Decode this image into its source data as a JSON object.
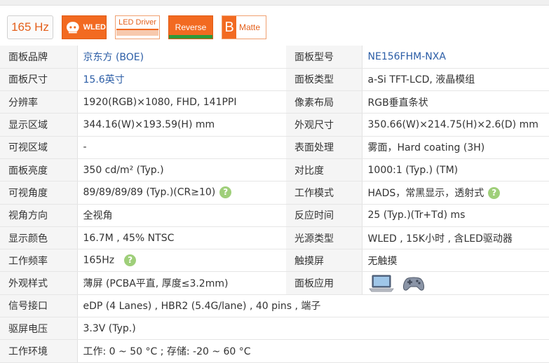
{
  "badges": {
    "refresh": "165 Hz",
    "backlight": "WLED",
    "driver": "LED Driver",
    "orientation": "Reverse",
    "surface_letter": "B",
    "surface": "Matte"
  },
  "specs": {
    "brand_label": "面板品牌",
    "brand": "京东方 (BOE)",
    "model_label": "面板型号",
    "model": "NE156FHM-NXA",
    "size_label": "面板尺寸",
    "size": "15.6英寸",
    "type_label": "面板类型",
    "type": "a-Si TFT-LCD, 液晶模组",
    "resolution_label": "分辨率",
    "resolution": "1920(RGB)×1080, FHD, 141PPI",
    "pixel_label": "像素布局",
    "pixel": "RGB垂直条状",
    "display_area_label": "显示区域",
    "display_area": "344.16(W)×193.59(H) mm",
    "outline_label": "外观尺寸",
    "outline": "350.66(W)×214.75(H)×2.6(D) mm",
    "viewing_area_label": "可视区域",
    "viewing_area": "-",
    "surface_label": "表面处理",
    "surface": "雾面，Hard coating (3H)",
    "brightness_label": "面板亮度",
    "brightness": "350 cd/m² (Typ.)",
    "contrast_label": "对比度",
    "contrast": "1000:1 (Typ.) (TM)",
    "viewing_angle_label": "可视角度",
    "viewing_angle": "89/89/89/89 (Typ.)(CR≥10)",
    "mode_label": "工作模式",
    "mode": "HADS，常黑显示，透射式",
    "view_dir_label": "视角方向",
    "view_dir": "全视角",
    "response_label": "反应时间",
    "response": "25 (Typ.)(Tr+Td) ms",
    "colors_label": "显示颜色",
    "colors": "16.7M , 45% NTSC",
    "light_label": "光源类型",
    "light": "WLED , 15K小时 , 含LED驱动器",
    "freq_label": "工作频率",
    "freq": "165Hz",
    "touch_label": "触摸屏",
    "touch": "无触摸",
    "style_label": "外观样式",
    "style": "薄屏 (PCBA平直, 厚度≤3.2mm)",
    "app_label": "面板应用",
    "app_icons": [
      "laptop-icon",
      "gamepad-icon"
    ],
    "signal_label": "信号接口",
    "signal": "eDP (4 Lanes) , HBR2 (5.4G/lane) , 40 pins , 端子",
    "voltage_label": "驱屏电压",
    "voltage": "3.3V (Typ.)",
    "env_label": "工作环境",
    "env": "工作: 0 ~ 50 °C ; 存储: -20 ~ 60 °C"
  },
  "help_glyph": "?",
  "colors": {
    "accent": "#f26a21",
    "link": "#2b5da6",
    "help": "#9fcf7a",
    "label_bg": "#f5f5f5"
  }
}
